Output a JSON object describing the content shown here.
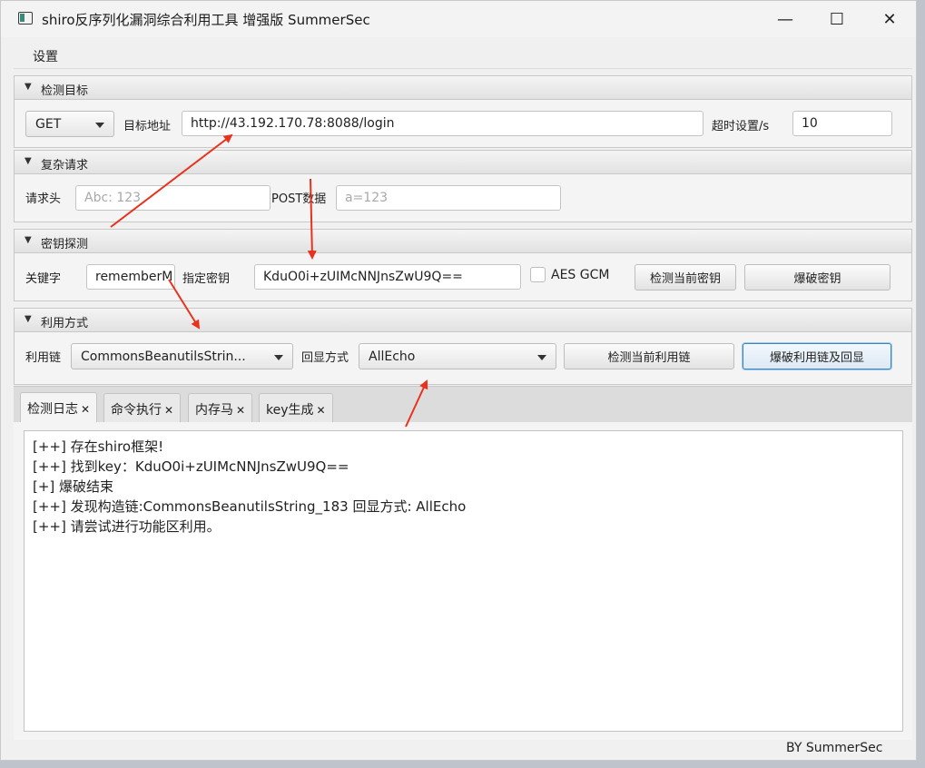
{
  "window": {
    "title": "shiro反序列化漏洞综合利用工具 增强版 SummerSec",
    "minimize": "—",
    "maximize": "☐",
    "close": "✕"
  },
  "menu": {
    "settings": "设置"
  },
  "detect_target": {
    "header": "检测目标",
    "method": "GET",
    "target_label": "目标地址",
    "url": "http://43.192.170.78:8088/login",
    "timeout_label": "超时设置/s",
    "timeout": "10"
  },
  "complex_request": {
    "header": "复杂请求",
    "headers_label": "请求头",
    "headers_placeholder": "Abc: 123",
    "post_label": "POST数据",
    "post_placeholder": "a=123"
  },
  "key_probe": {
    "header": "密钥探测",
    "keyword_label": "关键字",
    "keyword": "rememberM",
    "key_label": "指定密钥",
    "key": "KduO0i+zUIMcNNJnsZwU9Q==",
    "aes_gcm_label": "AES GCM",
    "detect_key_button": "检测当前密钥",
    "brute_key_button": "爆破密钥"
  },
  "exploit": {
    "header": "利用方式",
    "chain_label": "利用链",
    "chain": "CommonsBeanutilsStrin...",
    "echo_label": "回显方式",
    "echo": "AllEcho",
    "detect_chain_button": "检测当前利用链",
    "brute_chain_button": "爆破利用链及回显"
  },
  "tabs": [
    {
      "label": "检测日志",
      "close": "✕"
    },
    {
      "label": "命令执行",
      "close": "✕"
    },
    {
      "label": "内存马",
      "close": "✕"
    },
    {
      "label": "key生成",
      "close": "✕"
    }
  ],
  "log": [
    "[++] 存在shiro框架!",
    "[++] 找到key：KduO0i+zUIMcNNJnsZwU9Q==",
    "[+] 爆破结束",
    "[++] 发现构造链:CommonsBeanutilsString_183  回显方式: AllEcho",
    "[++] 请尝试进行功能区利用。"
  ],
  "footer": "BY   SummerSec",
  "colors": {
    "arrow": "#e8321e",
    "focus_border": "#3b87c4"
  }
}
